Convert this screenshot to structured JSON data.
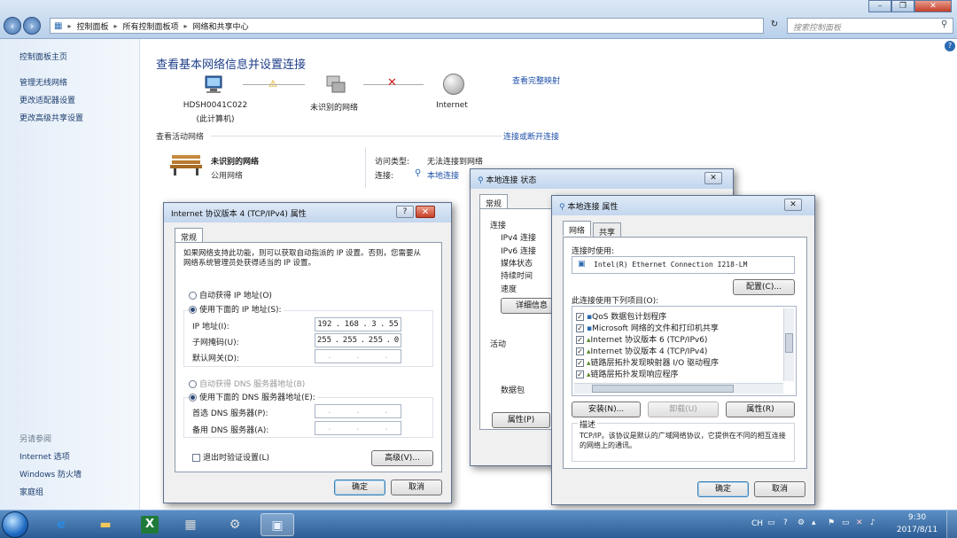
{
  "explorer": {
    "breadcrumb": [
      "控制面板",
      "所有控制面板项",
      "网络和共享中心"
    ],
    "search_placeholder": "搜索控制面板",
    "window_buttons": [
      "–",
      "❐",
      "✕"
    ]
  },
  "left_pane": {
    "links": [
      "控制面板主页",
      "管理无线网络",
      "更改适配器设置",
      "更改高级共享设置"
    ],
    "see_also_label": "另请参阅",
    "see_also": [
      "Internet 选项",
      "Windows 防火墙",
      "家庭组"
    ]
  },
  "main": {
    "title": "查看基本网络信息并设置连接",
    "view_full_map": "查看完整映射",
    "nodes": [
      {
        "label": "HDSH0041C022",
        "sub": "(此计算机)"
      },
      {
        "label": "未识别的网络",
        "sub": ""
      },
      {
        "label": "Internet",
        "sub": ""
      }
    ],
    "active_networks_label": "查看活动网络",
    "connect_disconnect": "连接或断开连接",
    "network_name": "未识别的网络",
    "network_type": "公用网络",
    "access_type_label": "访问类型:",
    "access_type_value": "无法连接到网络",
    "connections_label": "连接:",
    "connections_value": "本地连接"
  },
  "status_dialog": {
    "title": "本地连接 状态",
    "tab": "常规",
    "section_connection": "连接",
    "rows": [
      "IPv4 连接",
      "IPv6 连接",
      "媒体状态",
      "持续时间",
      "速度"
    ],
    "details_button": "详细信息",
    "section_activity": "活动",
    "packets_label": "数据包",
    "properties_button": "属性(P)"
  },
  "props_dialog": {
    "title": "本地连接 属性",
    "tabs": [
      "网络",
      "共享"
    ],
    "connect_using_label": "连接时使用:",
    "adapter": "Intel(R) Ethernet Connection I218-LM",
    "configure_button": "配置(C)...",
    "items_label": "此连接使用下列项目(O):",
    "items": [
      "QoS 数据包计划程序",
      "Microsoft 网络的文件和打印机共享",
      "Internet 协议版本 6 (TCP/IPv6)",
      "Internet 协议版本 4 (TCP/IPv4)",
      "链路层拓扑发现映射器 I/O 驱动程序",
      "链路层拓扑发现响应程序"
    ],
    "install_button": "安装(N)...",
    "uninstall_button": "卸载(U)",
    "properties_button": "属性(R)",
    "description_label": "描述",
    "description": "TCP/IP。该协议是默认的广域网络协议，它提供在不同的相互连接的网络上的通讯。",
    "ok_button": "确定",
    "cancel_button": "取消"
  },
  "ipv4_dialog": {
    "title": "Internet 协议版本 4 (TCP/IPv4) 属性",
    "help_button": "?",
    "tab": "常规",
    "intro": "如果网络支持此功能，则可以获取自动指派的 IP 设置。否则，您需要从网络系统管理员处获得适当的 IP 设置。",
    "auto_ip": "自动获得 IP 地址(O)",
    "manual_ip": "使用下面的 IP 地址(S):",
    "ip_label": "IP 地址(I):",
    "ip_value": [
      "192",
      "168",
      "3",
      "55"
    ],
    "mask_label": "子网掩码(U):",
    "mask_value": [
      "255",
      "255",
      "255",
      "0"
    ],
    "gateway_label": "默认网关(D):",
    "auto_dns": "自动获得 DNS 服务器地址(B)",
    "manual_dns": "使用下面的 DNS 服务器地址(E):",
    "dns1_label": "首选 DNS 服务器(P):",
    "dns2_label": "备用 DNS 服务器(A):",
    "validate_label": "退出时验证设置(L)",
    "advanced_button": "高级(V)...",
    "ok_button": "确定",
    "cancel_button": "取消"
  },
  "taskbar": {
    "lang": "CH",
    "time": "9:30",
    "date": "2017/8/11"
  }
}
